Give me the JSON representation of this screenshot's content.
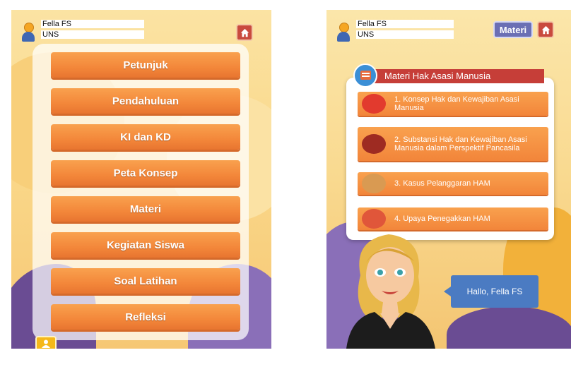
{
  "user": {
    "name": "Fella FS",
    "school": "UNS"
  },
  "left_screen": {
    "menu": [
      "Petunjuk",
      "Pendahuluan",
      "KI dan KD",
      "Peta Konsep",
      "Materi",
      "Kegiatan Siswa",
      "Soal Latihan",
      "Refleksi"
    ]
  },
  "right_screen": {
    "materi_label": "Materi",
    "card_title": "Materi Hak Asasi Manusia",
    "topics": [
      "1. Konsep Hak dan Kewajiban Asasi Manusia",
      "2. Substansi Hak dan Kewajiban Asasi Manusia dalam Perspektif Pancasila",
      "3. Kasus Pelanggaran HAM",
      "4. Upaya Penegakkan HAM"
    ],
    "greeting": "Hallo, Fella FS"
  },
  "icons": [
    "home-icon",
    "avatar-icon",
    "user-icon",
    "book-icon",
    "scales-icon",
    "eagle-icon",
    "hands-icon",
    "justice-icon"
  ],
  "colors": {
    "accent_orange": "#f3873a",
    "home_red": "#c94a3e",
    "materi_purple": "#6b6fb4",
    "title_red": "#c63e38",
    "bubble_blue": "#4b7bc2"
  }
}
